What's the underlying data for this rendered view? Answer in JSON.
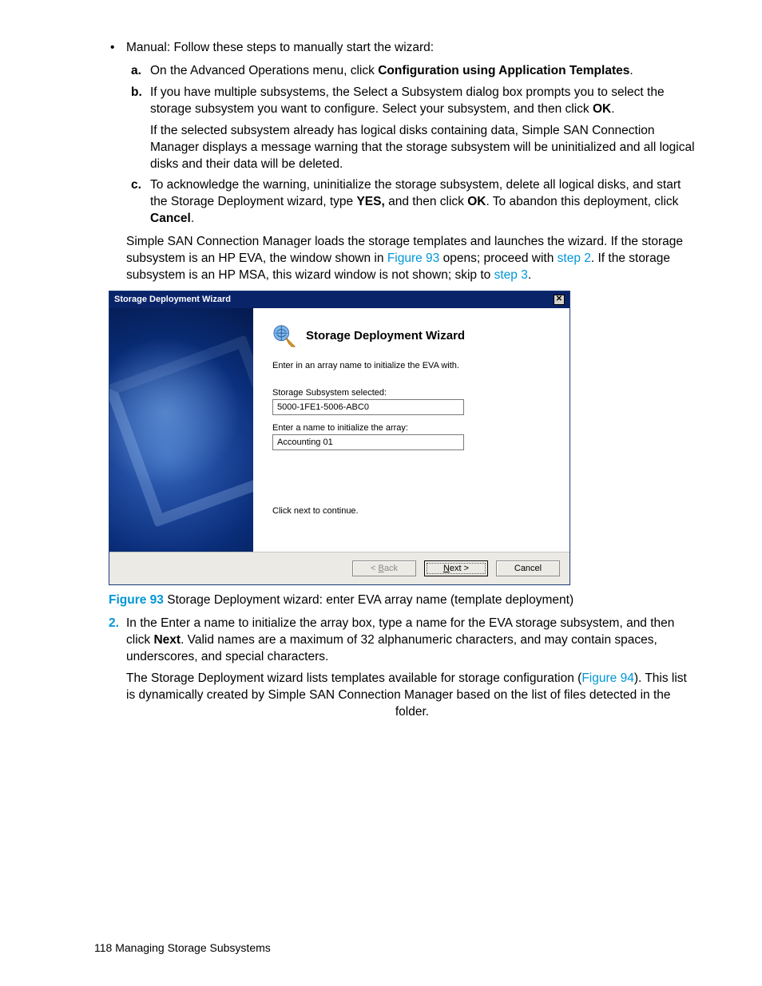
{
  "bullet_intro": "Manual: Follow these steps to manually start the wizard:",
  "steps_alpha": {
    "a": {
      "marker": "a.",
      "pre": "On the Advanced Operations menu, click ",
      "bold": "Configuration using Application Templates",
      "post": "."
    },
    "b": {
      "marker": "b.",
      "p1a": "If you have multiple subsystems, the Select a Subsystem dialog box prompts you to select the storage subsystem you want to configure. Select your subsystem, and then click ",
      "p1bold": "OK",
      "p1b": ".",
      "p2": "If the selected subsystem already has logical disks containing data, Simple SAN Connection Manager displays a message warning that the storage subsystem will be uninitialized and all logical disks and their data will be deleted."
    },
    "c": {
      "marker": "c.",
      "t1": "To acknowledge the warning, uninitialize the storage subsystem, delete all logical disks, and start the Storage Deployment wizard, type ",
      "b1": "YES,",
      "t2": " and then click ",
      "b2": "OK",
      "t3": ". To abandon this deployment, click ",
      "b3": "Cancel",
      "t4": "."
    }
  },
  "after_alpha": {
    "t1": "Simple SAN Connection Manager loads the storage templates and launches the wizard. If the storage subsystem is an HP EVA, the window shown in ",
    "link1": "Figure 93",
    "t2": " opens; proceed with ",
    "link2": "step 2",
    "t3": ". If the storage subsystem is an HP MSA, this wizard window is not shown; skip to ",
    "link3": "step 3",
    "t4": "."
  },
  "wizard": {
    "title": "Storage Deployment Wizard",
    "heading": "Storage Deployment Wizard",
    "intro": "Enter in an array name to initialize the EVA with.",
    "label_selected": "Storage Subsystem selected:",
    "value_selected": "5000-1FE1-5006-ABC0",
    "label_name": "Enter a name to initialize the array:",
    "value_name": "Accounting 01",
    "continue_text": "Click next to continue.",
    "btn_back_pre": "< ",
    "btn_back_u": "B",
    "btn_back_rest": "ack",
    "btn_next_u": "N",
    "btn_next_rest": "ext >",
    "btn_cancel": "Cancel"
  },
  "fig93": {
    "label": "Figure 93",
    "caption": "  Storage Deployment wizard: enter EVA array name (template deployment)"
  },
  "step2": {
    "marker": "2.",
    "p1a": "In the Enter a name to initialize the array box, type a name for the EVA storage subsystem, and then click ",
    "p1bold": "Next",
    "p1b": ". Valid names are a maximum of 32 alphanumeric characters, and may contain spaces, underscores, and special characters.",
    "p2a": "The Storage Deployment wizard lists templates available for storage configuration (",
    "p2link": "Figure 94",
    "p2b": "). This list is dynamically created by Simple SAN Connection Manager based on the list of files detected in the ",
    "p2c": " folder."
  },
  "footer": {
    "page": "118",
    "section": "   Managing Storage Subsystems"
  }
}
